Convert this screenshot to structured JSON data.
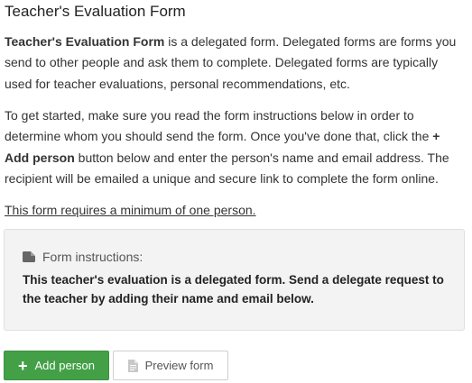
{
  "page": {
    "title": "Teacher's Evaluation Form"
  },
  "intro": {
    "form_name": "Teacher's Evaluation Form",
    "text": " is a delegated form. Delegated forms are forms you send to other people and ask them to complete. Delegated forms are typically used for teacher evaluations, personal recommendations, etc."
  },
  "instructions_text": {
    "before": "To get started, make sure you read the form instructions below in order to determine whom you should send the form. Once you've done that, click the ",
    "bold": "+ Add person",
    "after": " button below and enter the person's name and email address. The recipient will be emailed a unique and secure link to complete the form online."
  },
  "requirement": "This form requires a minimum of one person.",
  "instructions_box": {
    "heading": "Form instructions:",
    "icon": "folder-icon",
    "body": "This teacher's evaluation is a delegated form. Send a delegate request to the teacher by adding their name and email below."
  },
  "buttons": {
    "add_person": "Add person",
    "add_icon": "plus-icon",
    "preview": "Preview form",
    "preview_icon": "document-icon"
  },
  "colors": {
    "add_button": "#43a047",
    "instructions_bg": "#f3f3f3"
  }
}
